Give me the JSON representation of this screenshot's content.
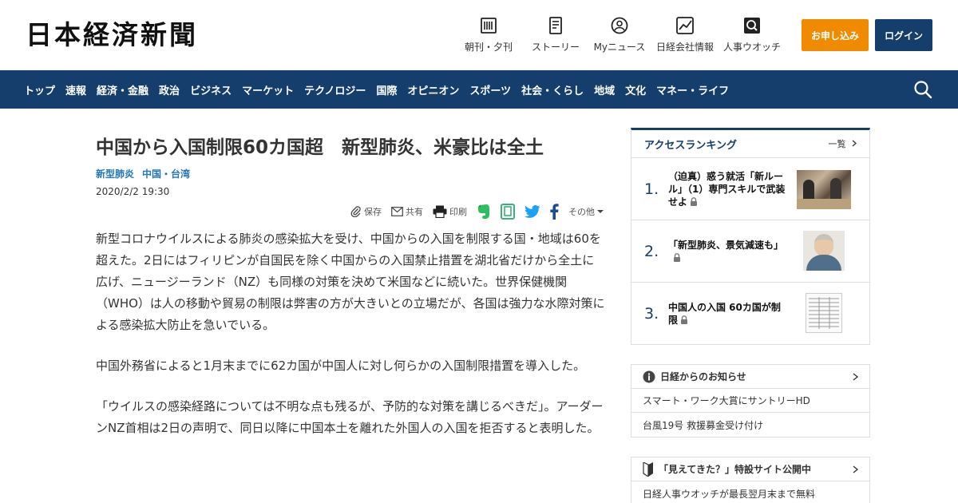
{
  "header": {
    "logo": "日本経済新聞",
    "nav_icons": [
      {
        "label": "朝刊・夕刊",
        "icon": "newspaper-icon"
      },
      {
        "label": "ストーリー",
        "icon": "story-icon"
      },
      {
        "label": "Myニュース",
        "icon": "user-icon"
      },
      {
        "label": "日経会社情報",
        "icon": "chart-icon"
      },
      {
        "label": "人事ウオッチ",
        "icon": "search-person-icon"
      }
    ],
    "subscribe_label": "お申し込み",
    "login_label": "ログイン"
  },
  "global_nav": {
    "items": [
      "トップ",
      "速報",
      "経済・金融",
      "政治",
      "ビジネス",
      "マーケット",
      "テクノロジー",
      "国際",
      "オピニオン",
      "スポーツ",
      "社会・くらし",
      "地域",
      "文化",
      "マネー・ライフ"
    ]
  },
  "article": {
    "headline": "中国から入国制限60カ国超　新型肺炎、米豪比は全土",
    "tags": [
      "新型肺炎",
      "中国・台湾"
    ],
    "date": "2020/2/2 19:30",
    "share": {
      "save": "保存",
      "share": "共有",
      "print": "印刷",
      "more": "その他"
    },
    "paragraphs": [
      "新型コロナウイルスによる肺炎の感染拡大を受け、中国からの入国を制限する国・地域は60を超えた。2日にはフィリピンが自国民を除く中国からの入国禁止措置を湖北省だけから全土に広げ、ニュージーランド（NZ）も同様の対策を決めて米国などに続いた。世界保健機関（WHO）は人の移動や貿易の制限は弊害の方が大きいとの立場だが、各国は強力な水際対策による感染拡大防止を急いでいる。",
      "中国外務省によると1月末までに62カ国が中国人に対し何らかの入国制限措置を導入した。",
      "「ウイルスの感染経路については不明な点も残るが、予防的な対策を講じるべきだ」。アーダーンNZ首相は2日の声明で、同日以降に中国本土を離れた外国人の入国を拒否すると表明した。"
    ]
  },
  "sidebar": {
    "ranking": {
      "title": "アクセスランキング",
      "more": "一覧",
      "items": [
        {
          "rank": "1.",
          "title": "（迫真）惑う就活「新ルール」（1）専門スキルで武装せよ"
        },
        {
          "rank": "2.",
          "title": "「新型肺炎、景気減速も」"
        },
        {
          "rank": "3.",
          "title": "中国人の入国 60カ国が制限"
        }
      ]
    },
    "notice": {
      "title": "日経からのお知らせ",
      "items": [
        "スマート・ワーク大賞にサントリーHD",
        "台風19号 救援募金受け付け"
      ]
    },
    "promo": {
      "title": "「見えてきた？」特設サイト公開中",
      "items": [
        "日経人事ウオッチが最長翌月末まで無料"
      ]
    }
  },
  "colors": {
    "brand_navy": "#153e6d",
    "subscribe_orange": "#f08b00",
    "tag_blue": "#2376b8"
  }
}
